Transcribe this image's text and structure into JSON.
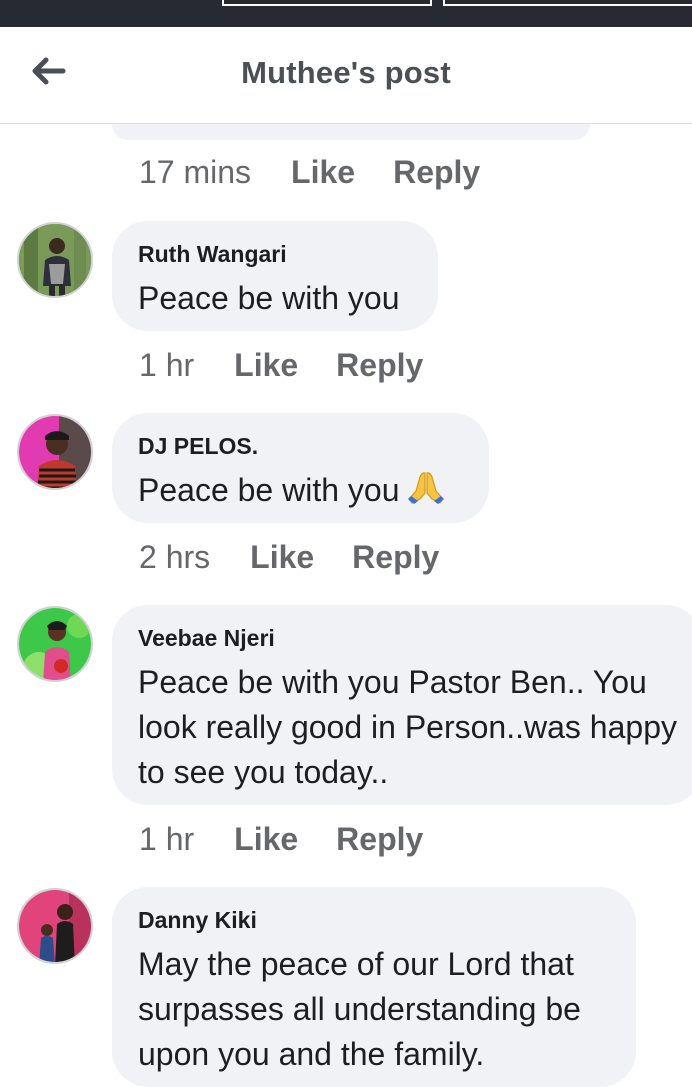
{
  "header": {
    "title": "Muthee's post",
    "back_icon": "arrow-left-icon"
  },
  "previous_comment_meta": {
    "time": "17 mins",
    "like": "Like",
    "reply": "Reply"
  },
  "comments": [
    {
      "author": "Ruth Wangari",
      "text": "Peace be with you",
      "time": "1 hr",
      "like": "Like",
      "reply": "Reply"
    },
    {
      "author": "DJ PELOS.",
      "text": "Peace be with you",
      "emoji": "folded-hands-icon",
      "time": "2 hrs",
      "like": "Like",
      "reply": "Reply"
    },
    {
      "author": "Veebae Njeri",
      "text": "Peace be with you Pastor Ben.. You look really good in Person..was happy to see you today..",
      "time": "1 hr",
      "like": "Like",
      "reply": "Reply"
    },
    {
      "author": "Danny Kiki",
      "text": "May the peace of our Lord that surpasses all understanding be upon you and the family."
    }
  ],
  "colors": {
    "status_bar": "#272a33",
    "bubble": "#f0f2f5",
    "meta_text": "#65676b",
    "title_text": "#4b4f56"
  }
}
